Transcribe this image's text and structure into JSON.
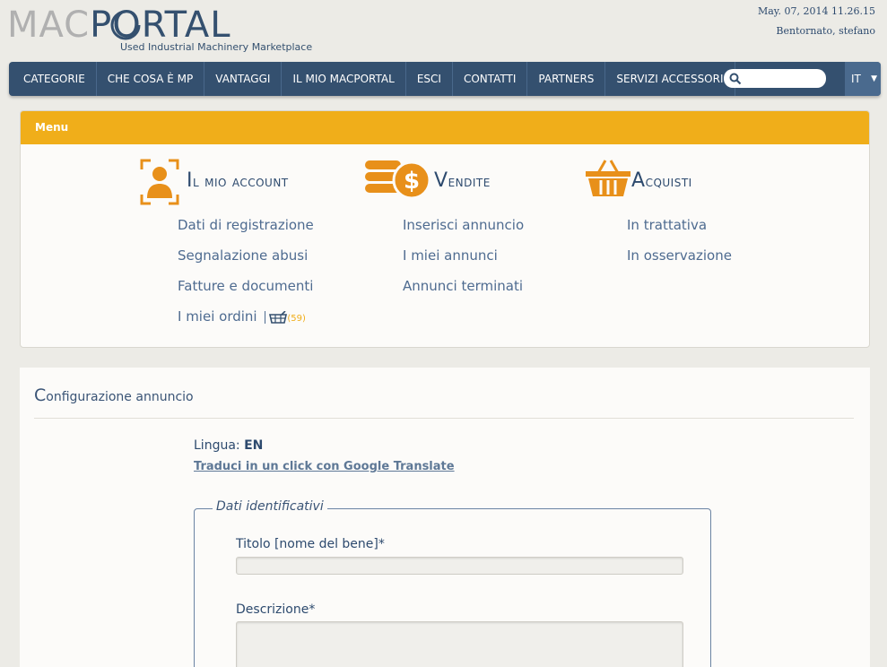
{
  "brand": {
    "mac": "MAC",
    "portal": "PORTAL",
    "tagline": "Used Industrial Machinery Marketplace"
  },
  "header": {
    "datetime": "May. 07, 2014 11.26.15",
    "user": "Bentornato, stefano"
  },
  "nav": {
    "items": [
      "CATEGORIE",
      "CHE COSA È MP",
      "VANTAGGI",
      "IL MIO MACPORTAL",
      "ESCI",
      "CONTATTI",
      "PARTNERS",
      "SERVIZI ACCESSORI"
    ],
    "search_placeholder": "",
    "language": "IT",
    "search_icon": "search-icon",
    "lang_chevron_icon": "chevron-down-icon"
  },
  "menu": {
    "title": "Menu",
    "accent_color": "#f0ae1a",
    "account": {
      "title_cap": "I",
      "title_rest": "l mio account",
      "icon": "user-account-icon",
      "items": [
        "Dati di registrazione",
        "Segnalazione abusi",
        "Fatture e documenti",
        "I miei ordini"
      ],
      "cart_count": "(59)",
      "cart_icon": "shopping-basket-icon"
    },
    "vendite": {
      "title_cap": "V",
      "title_rest": "endite",
      "icon": "coins-dollar-icon",
      "items": [
        "Inserisci annuncio",
        "I miei annunci",
        "Annunci terminati"
      ]
    },
    "acquisti": {
      "title_cap": "A",
      "title_rest": "cquisti",
      "icon": "shopping-basket-icon",
      "items": [
        "In trattativa",
        "In osservazione"
      ]
    }
  },
  "content": {
    "title_cap": "C",
    "title_rest": "onfigurazione annuncio",
    "lingua_label": "Lingua:",
    "lingua_value": "EN",
    "translate_link": "Traduci in un click con Google Translate",
    "fieldset_legend": "Dati identificativi",
    "titolo_label": "Titolo [nome del bene]*",
    "titolo_value": "",
    "descrizione_label": "Descrizione*",
    "descrizione_value": ""
  },
  "colors": {
    "navbar": "#34506f",
    "accent": "#f0ae1a",
    "text": "#3a5476"
  }
}
